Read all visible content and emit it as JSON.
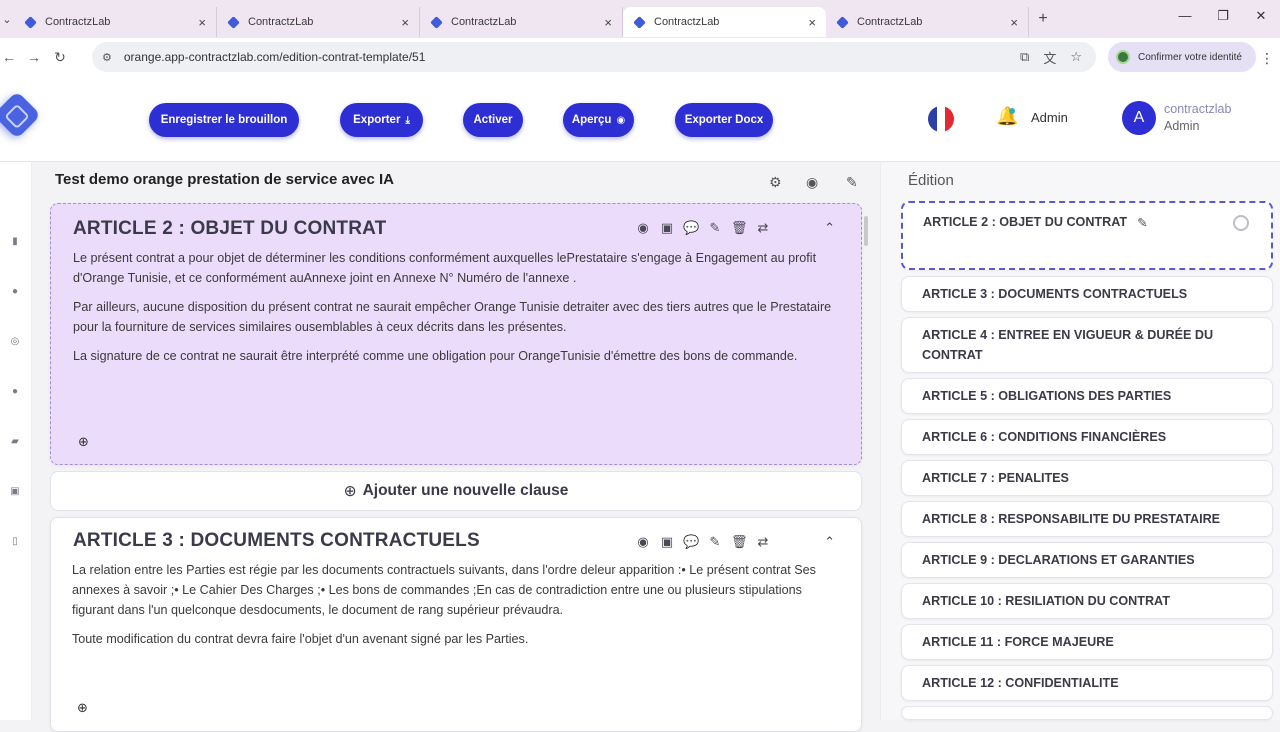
{
  "browser": {
    "tabs": [
      {
        "title": "ContractzLab"
      },
      {
        "title": "ContractzLab"
      },
      {
        "title": "ContractzLab"
      },
      {
        "title": "ContractzLab"
      },
      {
        "title": "ContractzLab"
      }
    ],
    "active_tab": 3,
    "url": "orange.app-contractzlab.com/edition-contrat-template/51",
    "identity_button": "Confirmer votre identité"
  },
  "header": {
    "buttons": {
      "save_draft": "Enregistrer le brouillon",
      "export": "Exporter",
      "activate": "Activer",
      "preview": "Aperçu",
      "export_docx": "Exporter Docx"
    },
    "notification_label": "Admin",
    "user": {
      "initial": "A",
      "name": "contractzlab",
      "role": "Admin"
    }
  },
  "document": {
    "title": "Test demo orange prestation de service avec IA",
    "add_clause_label": "Ajouter une nouvelle clause",
    "articles": [
      {
        "title": "ARTICLE 2 : OBJET DU CONTRAT",
        "paragraphs": [
          "Le présent contrat a pour objet de déterminer les conditions conformément auxquelles lePrestataire s'engage à Engagement au profit d'Orange Tunisie, et ce conformément auAnnexe joint en Annexe N° Numéro de l'annexe .",
          "Par ailleurs, aucune disposition du présent contrat ne saurait empêcher Orange Tunisie detraiter avec des tiers autres que le Prestataire pour la fourniture de services similaires ousemblables à ceux décrits dans les présentes.",
          "La signature de ce contrat ne saurait être interprété comme une obligation pour OrangeTunisie d'émettre des bons de commande."
        ]
      },
      {
        "title": "ARTICLE 3 : DOCUMENTS CONTRACTUELS",
        "paragraphs": [
          "La relation entre les Parties est régie par les documents contractuels suivants, dans l'ordre deleur apparition :• Le présent contrat Ses annexes à savoir ;• Le Cahier Des Charges ;• Les bons de commandes ;En cas de contradiction entre une ou plusieurs stipulations figurant dans l'un quelconque desdocuments, le document de rang supérieur prévaudra.",
          "Toute modification du contrat devra faire l'objet d'un avenant signé par les Parties."
        ]
      }
    ]
  },
  "edition_panel": {
    "title": "Édition",
    "items": [
      "ARTICLE 2 : OBJET DU CONTRAT",
      "ARTICLE 3 : DOCUMENTS CONTRACTUELS",
      "ARTICLE 4 : ENTREE EN VIGUEUR & DURÉE DU CONTRAT",
      "ARTICLE 5 : OBLIGATIONS DES PARTIES",
      "ARTICLE 6 : CONDITIONS FINANCIÈRES",
      "ARTICLE 7 : PENALITES",
      "ARTICLE 8 : RESPONSABILITE DU PRESTATAIRE",
      "ARTICLE 9 : DECLARATIONS ET GARANTIES",
      "ARTICLE 10 : RESILIATION DU CONTRAT",
      "ARTICLE 11 : FORCE MAJEURE",
      "ARTICLE 12 : CONFIDENTIALITE"
    ],
    "selected_index": 0
  },
  "colors": {
    "primary": "#2d2ed3",
    "selected_card_bg": "#ecdcfc",
    "tab_strip": "#efe6f2"
  }
}
